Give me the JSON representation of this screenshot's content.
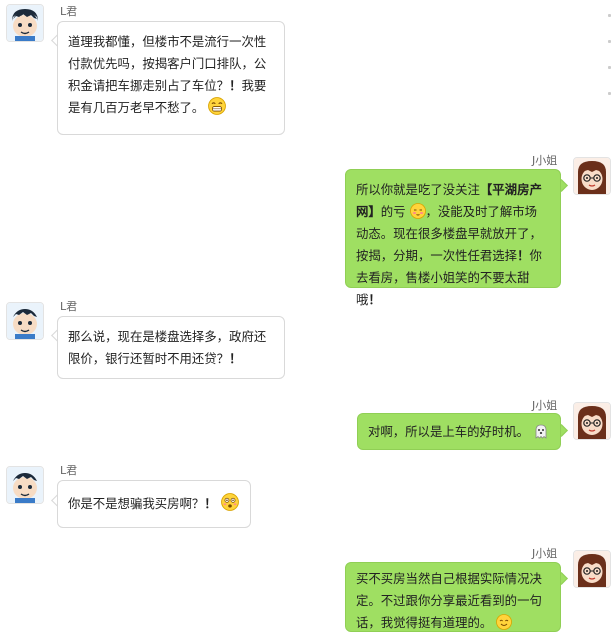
{
  "conversation": {
    "messages": [
      {
        "side": "left",
        "sender": "L君",
        "parts": [
          {
            "text": "道理我都懂，但楼市不是流行一次性"
          },
          {
            "text": "付款优先吗，按揭客户门口排队，公"
          },
          {
            "text": "积金请把车挪走别占了车位？"
          },
          {
            "text": "！",
            "bold": true
          },
          {
            "text": "我要"
          },
          {
            "text": "是有几百万老早不愁了。"
          },
          {
            "emoji": "grin-emoji"
          }
        ]
      },
      {
        "side": "right",
        "sender": "J小姐",
        "parts": [
          {
            "text": "所以你就是吃了没关注"
          },
          {
            "text": "【平湖房产",
            "bold": true
          },
          {
            "text": "网】",
            "bold": true
          },
          {
            "text": "的亏"
          },
          {
            "emoji": "shy-emoji"
          },
          {
            "text": "，没能及时了解市场"
          },
          {
            "text": "动态。现在很多楼盘早就放开了，"
          },
          {
            "text": "按揭，分期，一次性任君选择"
          },
          {
            "text": "！",
            "bold": true
          },
          {
            "text": "你"
          },
          {
            "text": "去看房，售楼小姐笑的不要太甜"
          },
          {
            "text": "哦"
          },
          {
            "text": "！",
            "bold": true
          }
        ]
      },
      {
        "side": "left",
        "sender": "L君",
        "parts": [
          {
            "text": "那么说，现在是楼盘选择多，政府还"
          },
          {
            "text": "限价，银行还暂时不用还贷？"
          },
          {
            "text": "！",
            "bold": true
          }
        ]
      },
      {
        "side": "right",
        "sender": "J小姐",
        "parts": [
          {
            "text": "对啊，所以是上车的好时机。"
          },
          {
            "emoji": "ghost-emoji"
          }
        ]
      },
      {
        "side": "left",
        "sender": "L君",
        "parts": [
          {
            "text": "你是不是想骗我买房啊？"
          },
          {
            "text": "！",
            "bold": true
          },
          {
            "emoji": "surprised-emoji"
          }
        ]
      },
      {
        "side": "right",
        "sender": "J小姐",
        "parts": [
          {
            "text": "买不买房当然自己根据实际情况决"
          },
          {
            "text": "定。不过跟你分享最近看到的一句"
          },
          {
            "text": "话，我觉得挺有道理的。"
          },
          {
            "emoji": "smile-emoji"
          }
        ]
      }
    ]
  },
  "colors": {
    "left_bubble": "#ffffff",
    "right_bubble": "#9fdf62",
    "sender_text": "#666666"
  }
}
